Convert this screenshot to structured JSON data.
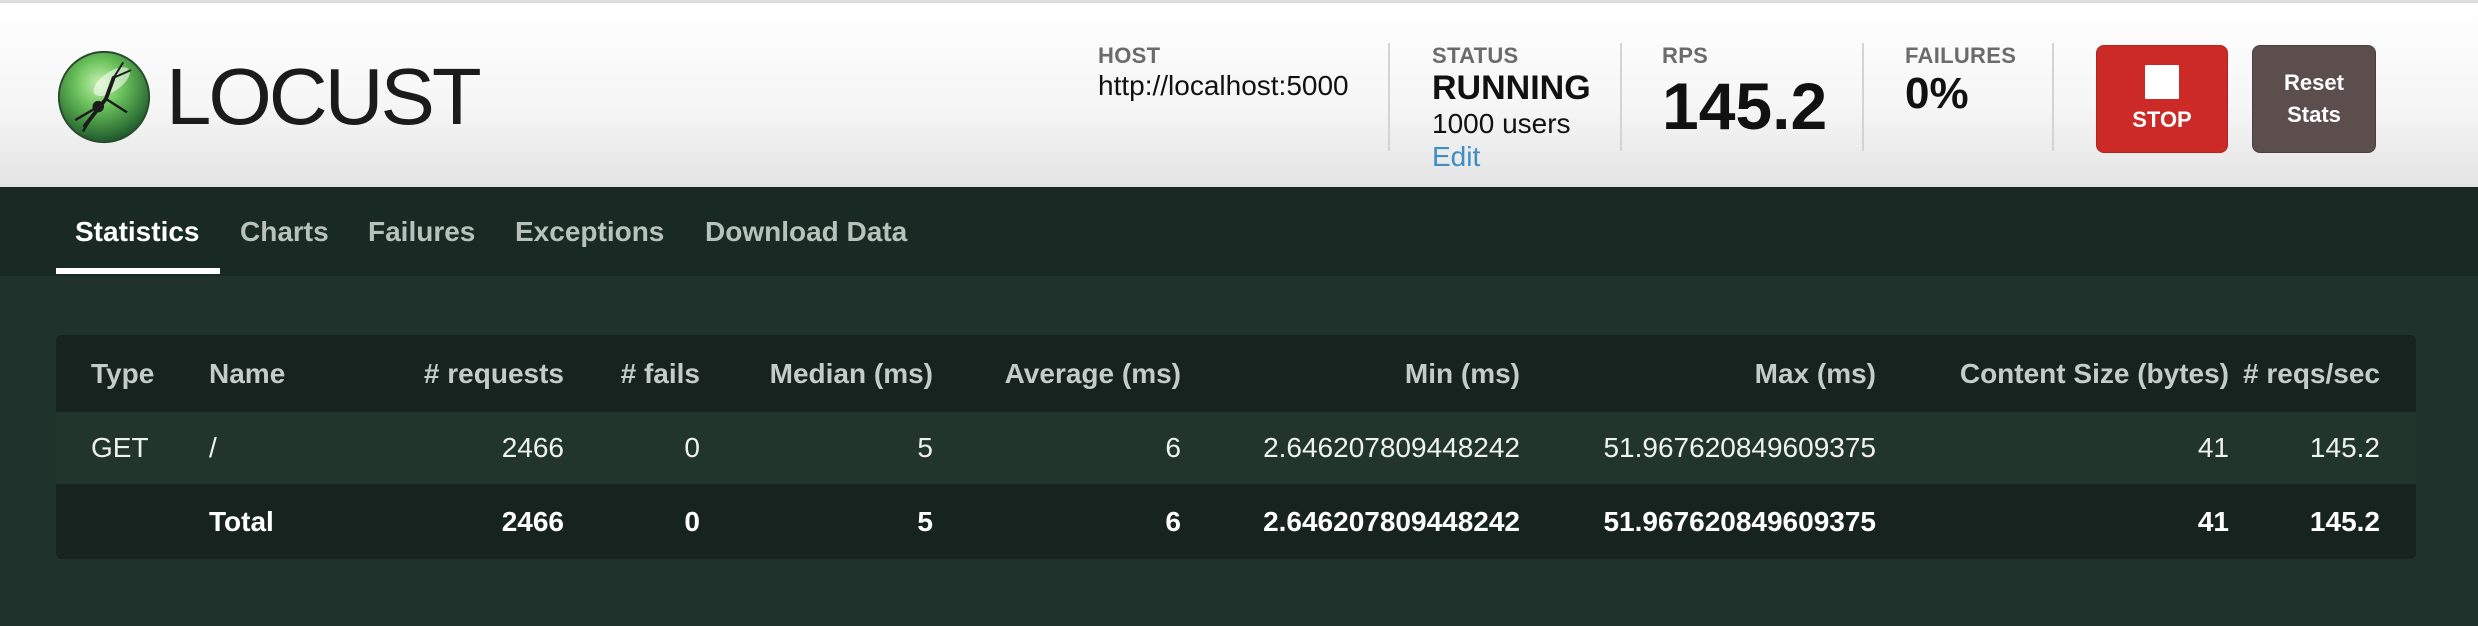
{
  "app": {
    "logo_text": "LOCUST"
  },
  "header": {
    "host": {
      "label": "HOST",
      "value": "http://localhost:5000"
    },
    "status": {
      "label": "STATUS",
      "value": "RUNNING",
      "users": "1000 users",
      "edit_label": "Edit"
    },
    "rps": {
      "label": "RPS",
      "value": "145.2"
    },
    "failures": {
      "label": "FAILURES",
      "value": "0%"
    },
    "stop_button_label": "STOP",
    "reset_button_label_line1": "Reset",
    "reset_button_label_line2": "Stats"
  },
  "nav": {
    "tabs": [
      {
        "label": "Statistics",
        "active": true
      },
      {
        "label": "Charts",
        "active": false
      },
      {
        "label": "Failures",
        "active": false
      },
      {
        "label": "Exceptions",
        "active": false
      },
      {
        "label": "Download Data",
        "active": false
      }
    ]
  },
  "table": {
    "columns": [
      "Type",
      "Name",
      "# requests",
      "# fails",
      "Median (ms)",
      "Average (ms)",
      "Min (ms)",
      "Max (ms)",
      "Content Size (bytes)",
      "# reqs/sec"
    ],
    "rows": [
      [
        "GET",
        "/",
        "2466",
        "0",
        "5",
        "6",
        "2.646207809448242",
        "51.967620849609375",
        "41",
        "145.2"
      ]
    ],
    "total": [
      "",
      "Total",
      "2466",
      "0",
      "5",
      "6",
      "2.646207809448242",
      "51.967620849609375",
      "41",
      "145.2"
    ]
  },
  "colors": {
    "header_bg": "#f6f6f6",
    "nav_bg": "#182a23",
    "page_bg": "#1f322b",
    "stop_button": "#cc2a27",
    "reset_button": "#5d4e4e",
    "link": "#3f8dc5"
  }
}
